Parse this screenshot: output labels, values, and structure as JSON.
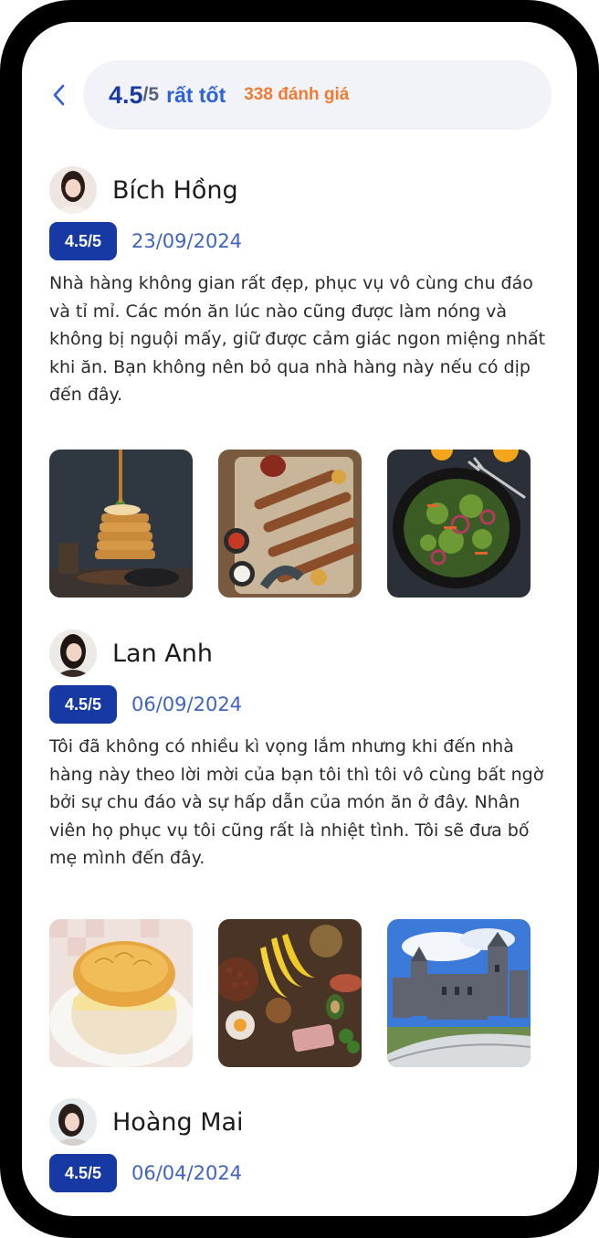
{
  "header": {
    "score": "4.5",
    "score_denominator": "/5",
    "score_word": "rất tốt",
    "review_count": "338 đánh giá"
  },
  "reviews": [
    {
      "name": "Bích Hồng",
      "rating": "4.5/5",
      "date": "23/09/2024",
      "text": "Nhà hàng không gian rất đẹp, phục vụ vô cùng chu đáo và tỉ mỉ. Các món ăn lúc nào cũng được làm nóng và không bị nguội mấy, giữ được cảm giác ngon miệng nhất khi ăn. Bạn không nên bỏ qua nhà hàng này nếu có dịp đến đây.",
      "photos": [
        "pancake-stack-photo",
        "grilled-skewers-photo",
        "salad-bowl-photo"
      ]
    },
    {
      "name": "Lan Anh",
      "rating": "4.5/5",
      "date": "06/09/2024",
      "text": "Tôi đã không có nhiều kì vọng lắm nhưng khi đến nhà hàng này theo lời mời của bạn tôi thì tôi vô cùng bất ngờ bởi sự chu đáo và sự hấp dẫn của món ăn ở đây. Nhân viên họ phục vụ tôi cũng rất là nhiệt tình. Tôi sẽ đưa bố mẹ mình đến đây.",
      "photos": [
        "pineapple-bun-photo",
        "groceries-spread-photo",
        "castle-photo"
      ]
    },
    {
      "name": "Hoàng Mai",
      "rating": "4.5/5",
      "date": "06/04/2024"
    }
  ],
  "colors": {
    "accent": "#1739a3",
    "score_word": "#2f62d6",
    "review_count": "#f07b32",
    "date": "#3f63bf"
  },
  "icons": {
    "back": "chevron-left-icon"
  }
}
